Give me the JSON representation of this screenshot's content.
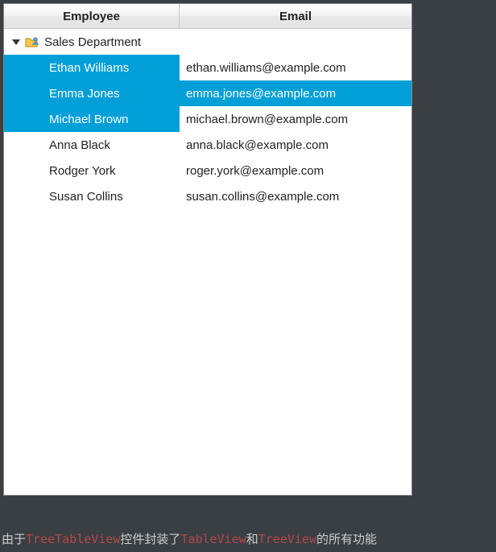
{
  "table": {
    "headers": {
      "employee": "Employee",
      "email": "Email"
    },
    "department": {
      "icon": "department-icon",
      "name": "Sales Department",
      "expanded": true
    },
    "rows": [
      {
        "name": "Ethan Williams",
        "email": "ethan.williams@example.com",
        "selected": true,
        "full_row_selected": false
      },
      {
        "name": "Emma Jones",
        "email": "emma.jones@example.com",
        "selected": true,
        "full_row_selected": true
      },
      {
        "name": "Michael Brown",
        "email": "michael.brown@example.com",
        "selected": true,
        "full_row_selected": false
      },
      {
        "name": "Anna Black",
        "email": "anna.black@example.com",
        "selected": false,
        "full_row_selected": false
      },
      {
        "name": "Rodger York",
        "email": "roger.york@example.com",
        "selected": false,
        "full_row_selected": false
      },
      {
        "name": "Susan Collins",
        "email": "susan.collins@example.com",
        "selected": false,
        "full_row_selected": false
      }
    ]
  },
  "caption": {
    "t1": "由于",
    "c1": "TreeTableView",
    "t2": "控件封装了",
    "c2": "TableView",
    "t3": "和",
    "c3": "TreeView",
    "t4": "的所有功能"
  }
}
